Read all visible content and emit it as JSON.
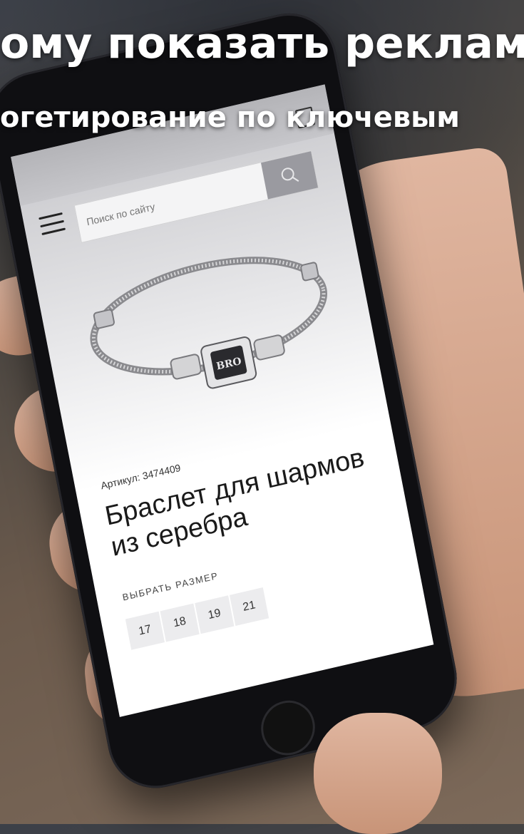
{
  "banner": {
    "headline": "ому показать реклам",
    "subheadline": "огетирование по ключевым"
  },
  "site": {
    "search": {
      "placeholder": "Поиск по сайту"
    },
    "product": {
      "article": "Артикул: 3474409",
      "title": "Браслет для шармов из серебра",
      "clasp_text": "BRO",
      "size_label": "ВЫБРАТЬ РАЗМЕР",
      "sizes": [
        "17",
        "18",
        "19",
        "21"
      ]
    }
  },
  "icons": {
    "menu": "hamburger-icon",
    "search": "search-icon",
    "cart": "cart-icon"
  },
  "colors": {
    "search_button": "#9a9aa0",
    "headline_text": "#ffffff"
  }
}
